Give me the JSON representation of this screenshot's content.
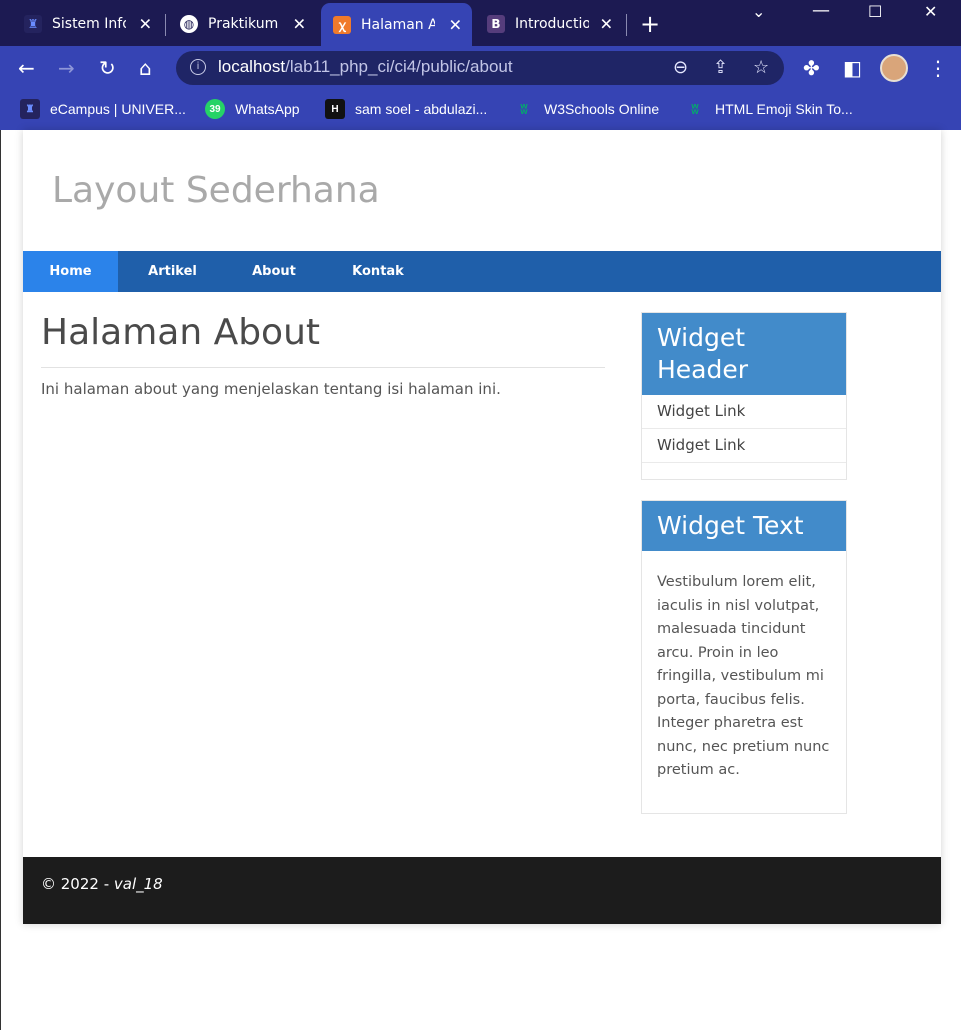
{
  "browser": {
    "tabs": [
      {
        "title": "Sistem Informasi",
        "icon": "university-logo-icon"
      },
      {
        "title": "Praktikum Web",
        "icon": "globe-icon"
      },
      {
        "title": "Halaman About",
        "icon": "xampp-icon",
        "active": true
      },
      {
        "title": "Introduction",
        "icon": "bootstrap-icon"
      }
    ],
    "tab_close_glyph": "✕",
    "new_tab_glyph": "+",
    "address": {
      "host": "localhost",
      "path": "/lab11_php_ci/ci4/public/about"
    },
    "bookmarks": [
      {
        "label": "eCampus | UNIVER...",
        "icon": "university-logo-icon"
      },
      {
        "label": "WhatsApp",
        "icon": "whatsapp-icon",
        "badge": "39"
      },
      {
        "label": "sam soel - abdulazi...",
        "icon": "hashnode-icon",
        "icon_text": "H"
      },
      {
        "label": "W3Schools Online",
        "icon": "w3schools-icon"
      },
      {
        "label": "HTML Emoji Skin To...",
        "icon": "w3schools-icon"
      }
    ]
  },
  "site": {
    "title": "Layout Sederhana",
    "nav": [
      {
        "label": "Home",
        "active": true
      },
      {
        "label": "Artikel"
      },
      {
        "label": "About"
      },
      {
        "label": "Kontak"
      }
    ],
    "page_heading": "Halaman About",
    "page_text": "Ini halaman about yang menjelaskan tentang isi halaman ini.",
    "widgets": [
      {
        "header": "Widget Header",
        "links": [
          "Widget Link",
          "Widget Link"
        ]
      },
      {
        "header": "Widget Text",
        "text": "Vestibulum lorem elit, iaculis in nisl volutpat, malesuada tincidunt arcu. Proin in leo fringilla, vestibulum mi porta, faucibus felis. Integer pharetra est nunc, nec pretium nunc pretium ac."
      }
    ],
    "footer": {
      "prefix": "© 2022 - ",
      "author": "val_18"
    }
  },
  "colors": {
    "tabbar": "#1c1a52",
    "toolbar": "#3644b4",
    "nav": "#1f5faa",
    "nav_active": "#2b83ea",
    "widget_header": "#428bca",
    "footer": "#1c1c1c"
  }
}
